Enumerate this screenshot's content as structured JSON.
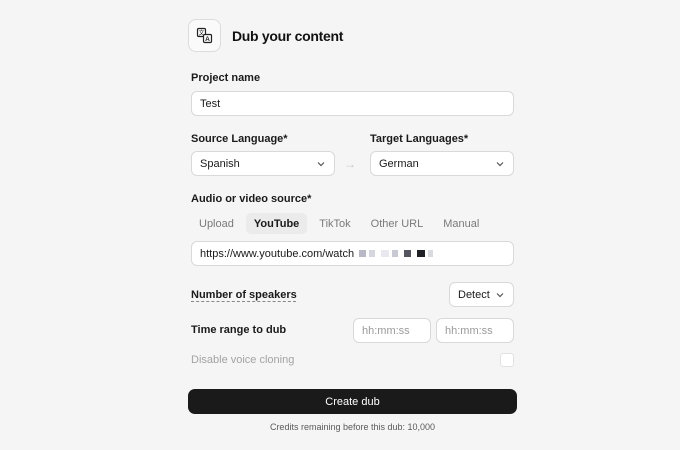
{
  "header": {
    "title": "Dub your content",
    "logo_icon": "translate-icon"
  },
  "project": {
    "label": "Project name",
    "value": "Test"
  },
  "source_language": {
    "label": "Source Language*",
    "value": "Spanish"
  },
  "target_languages": {
    "label": "Target Languages*",
    "value": "German"
  },
  "audio_source": {
    "label": "Audio or video source*",
    "tabs": [
      {
        "label": "Upload",
        "active": false
      },
      {
        "label": "YouTube",
        "active": true
      },
      {
        "label": "TikTok",
        "active": false
      },
      {
        "label": "Other URL",
        "active": false
      },
      {
        "label": "Manual",
        "active": false
      }
    ],
    "url_value": "https://www.youtube.com/watch"
  },
  "speakers": {
    "label": "Number of speakers",
    "value": "Detect"
  },
  "time_range": {
    "label": "Time range to dub",
    "start_placeholder": "hh:mm:ss",
    "end_placeholder": "hh:mm:ss"
  },
  "voice_cloning": {
    "label": "Disable voice cloning",
    "checked": false
  },
  "actions": {
    "create_label": "Create dub"
  },
  "credits_text": "Credits remaining before this dub: 10,000",
  "colors": {
    "primary_button": "#1a1a1a",
    "background": "#f5f5f5",
    "border": "#d9d9d9"
  }
}
